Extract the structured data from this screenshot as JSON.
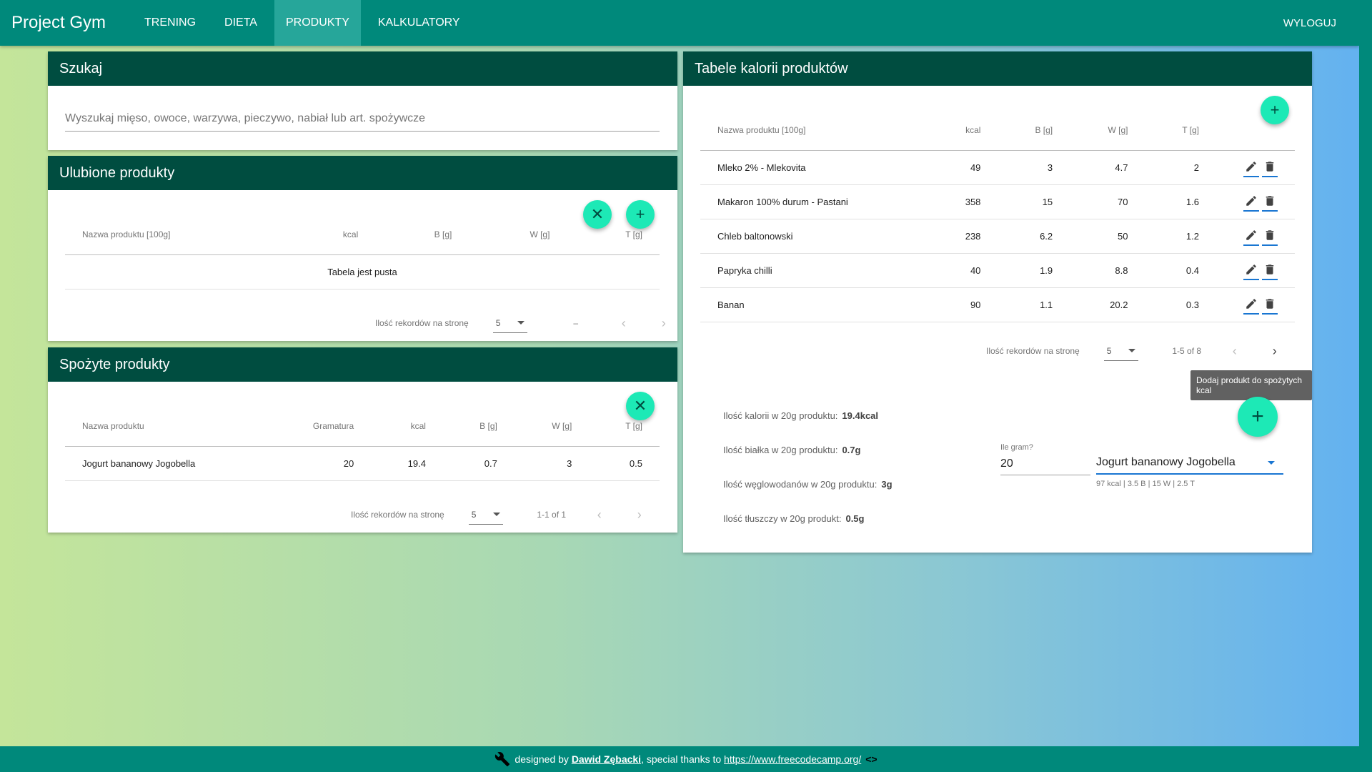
{
  "nav": {
    "brand": "Project Gym",
    "items": [
      "TRENING",
      "DIETA",
      "PRODUKTY",
      "KALKULATORY"
    ],
    "active": "PRODUKTY",
    "logout": "WYLOGUJ"
  },
  "search": {
    "title": "Szukaj",
    "placeholder": "Wyszukaj mięso, owoce, warzywa, pieczywo, nabiał lub art. spożywcze"
  },
  "favorites": {
    "title": "Ulubione produkty",
    "headers": [
      "Nazwa produktu [100g]",
      "kcal",
      "B [g]",
      "W [g]",
      "T [g]"
    ],
    "empty": "Tabela jest pusta",
    "pager": {
      "label": "Ilość rekordów na stronę",
      "per_page": "5",
      "range": "–"
    }
  },
  "consumed": {
    "title": "Spożyte produkty",
    "headers": [
      "Nazwa produktu",
      "Gramatura",
      "kcal",
      "B [g]",
      "W [g]",
      "T [g]"
    ],
    "rows": [
      {
        "name": "Jogurt bananowy Jogobella",
        "grams": "20",
        "kcal": "19.4",
        "b": "0.7",
        "w": "3",
        "t": "0.5"
      }
    ],
    "pager": {
      "label": "Ilość rekordów na stronę",
      "per_page": "5",
      "range": "1-1 of 1"
    }
  },
  "calories": {
    "title": "Tabele kalorii produktów",
    "headers": [
      "Nazwa produktu [100g]",
      "kcal",
      "B [g]",
      "W [g]",
      "T [g]"
    ],
    "rows": [
      {
        "name": "Mleko 2% - Mlekovita",
        "kcal": "49",
        "b": "3",
        "w": "4.7",
        "t": "2"
      },
      {
        "name": "Makaron 100% durum - Pastani",
        "kcal": "358",
        "b": "15",
        "w": "70",
        "t": "1.6"
      },
      {
        "name": "Chleb baltonowski",
        "kcal": "238",
        "b": "6.2",
        "w": "50",
        "t": "1.2"
      },
      {
        "name": "Papryka chilli",
        "kcal": "40",
        "b": "1.9",
        "w": "8.8",
        "t": "0.4"
      },
      {
        "name": "Banan",
        "kcal": "90",
        "b": "1.1",
        "w": "20.2",
        "t": "0.3"
      }
    ],
    "pager": {
      "label": "Ilość rekordów na stronę",
      "per_page": "5",
      "range": "1-5 of 8"
    },
    "tooltip": "Dodaj produkt do spożytych kcal",
    "stats": [
      {
        "label": "Ilość kalorii w 20g produktu:",
        "value": "19.4kcal"
      },
      {
        "label": "Ilość białka w 20g produktu:",
        "value": "0.7g"
      },
      {
        "label": "Ilość węglowodanów w 20g produktu:",
        "value": "3g"
      },
      {
        "label": "Ilość tłuszczy w 20g produkt:",
        "value": "0.5g"
      }
    ],
    "grams_label": "Ile gram?",
    "grams_value": "20",
    "product_selected": "Jogurt bananowy Jogobella",
    "product_hint": "97 kcal | 3.5 B | 15 W | 2.5 T"
  },
  "footer": {
    "prefix": "designed by",
    "author": "Dawid Zębacki",
    "middle": ", special thanks to",
    "link": "https://www.freecodecamp.org/",
    "code_icon": "<>"
  },
  "colors": {
    "primary": "#00897b",
    "dark": "#004d40",
    "fab": "#1de9b6"
  }
}
